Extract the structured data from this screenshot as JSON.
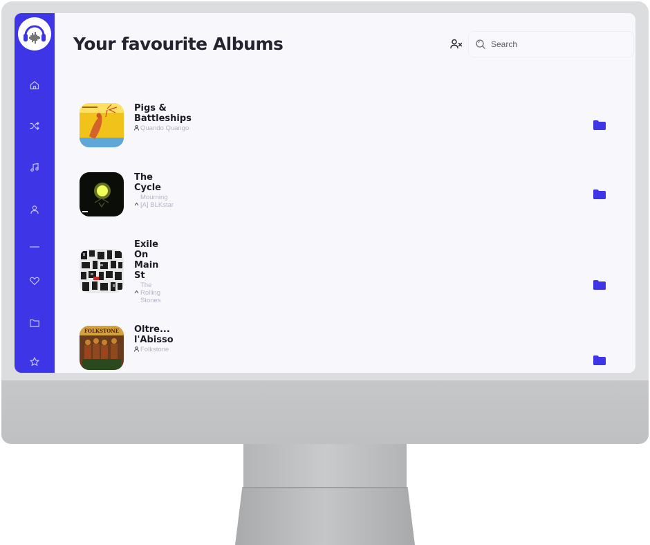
{
  "app": {
    "logo_name": "headphones-logo",
    "accent_color": "#3d35e6"
  },
  "sidebar": {
    "items": [
      {
        "name": "home",
        "icon": "home-icon"
      },
      {
        "name": "shuffle",
        "icon": "shuffle-icon"
      },
      {
        "name": "music",
        "icon": "music-note-icon"
      },
      {
        "name": "artists",
        "icon": "user-icon"
      },
      {
        "name": "divider",
        "icon": "minus-icon"
      },
      {
        "name": "favourites",
        "icon": "heart-icon"
      },
      {
        "name": "albums",
        "icon": "folder-icon"
      },
      {
        "name": "starred",
        "icon": "star-icon"
      }
    ]
  },
  "header": {
    "title": "Your favourite Albums",
    "search_placeholder": "Search",
    "user_action_icon": "user-x-icon"
  },
  "albums": [
    {
      "title": "Pigs & Battleships",
      "artist": "Quando Quango",
      "cover": "yellow-figure-cover",
      "action_icon": "folder-icon"
    },
    {
      "title": "The Cycle",
      "artist": "Mourning [A] BLKstar",
      "cover": "glowing-lamp-cover",
      "action_icon": "folder-icon"
    },
    {
      "title": "Exile On Main St",
      "artist": "The Rolling Stones",
      "cover": "photo-collage-cover",
      "action_icon": "folder-icon"
    },
    {
      "title": "Oltre... l'Abisso",
      "artist": "Folkstone",
      "cover": "warriors-painting-cover",
      "action_icon": "folder-icon"
    }
  ]
}
